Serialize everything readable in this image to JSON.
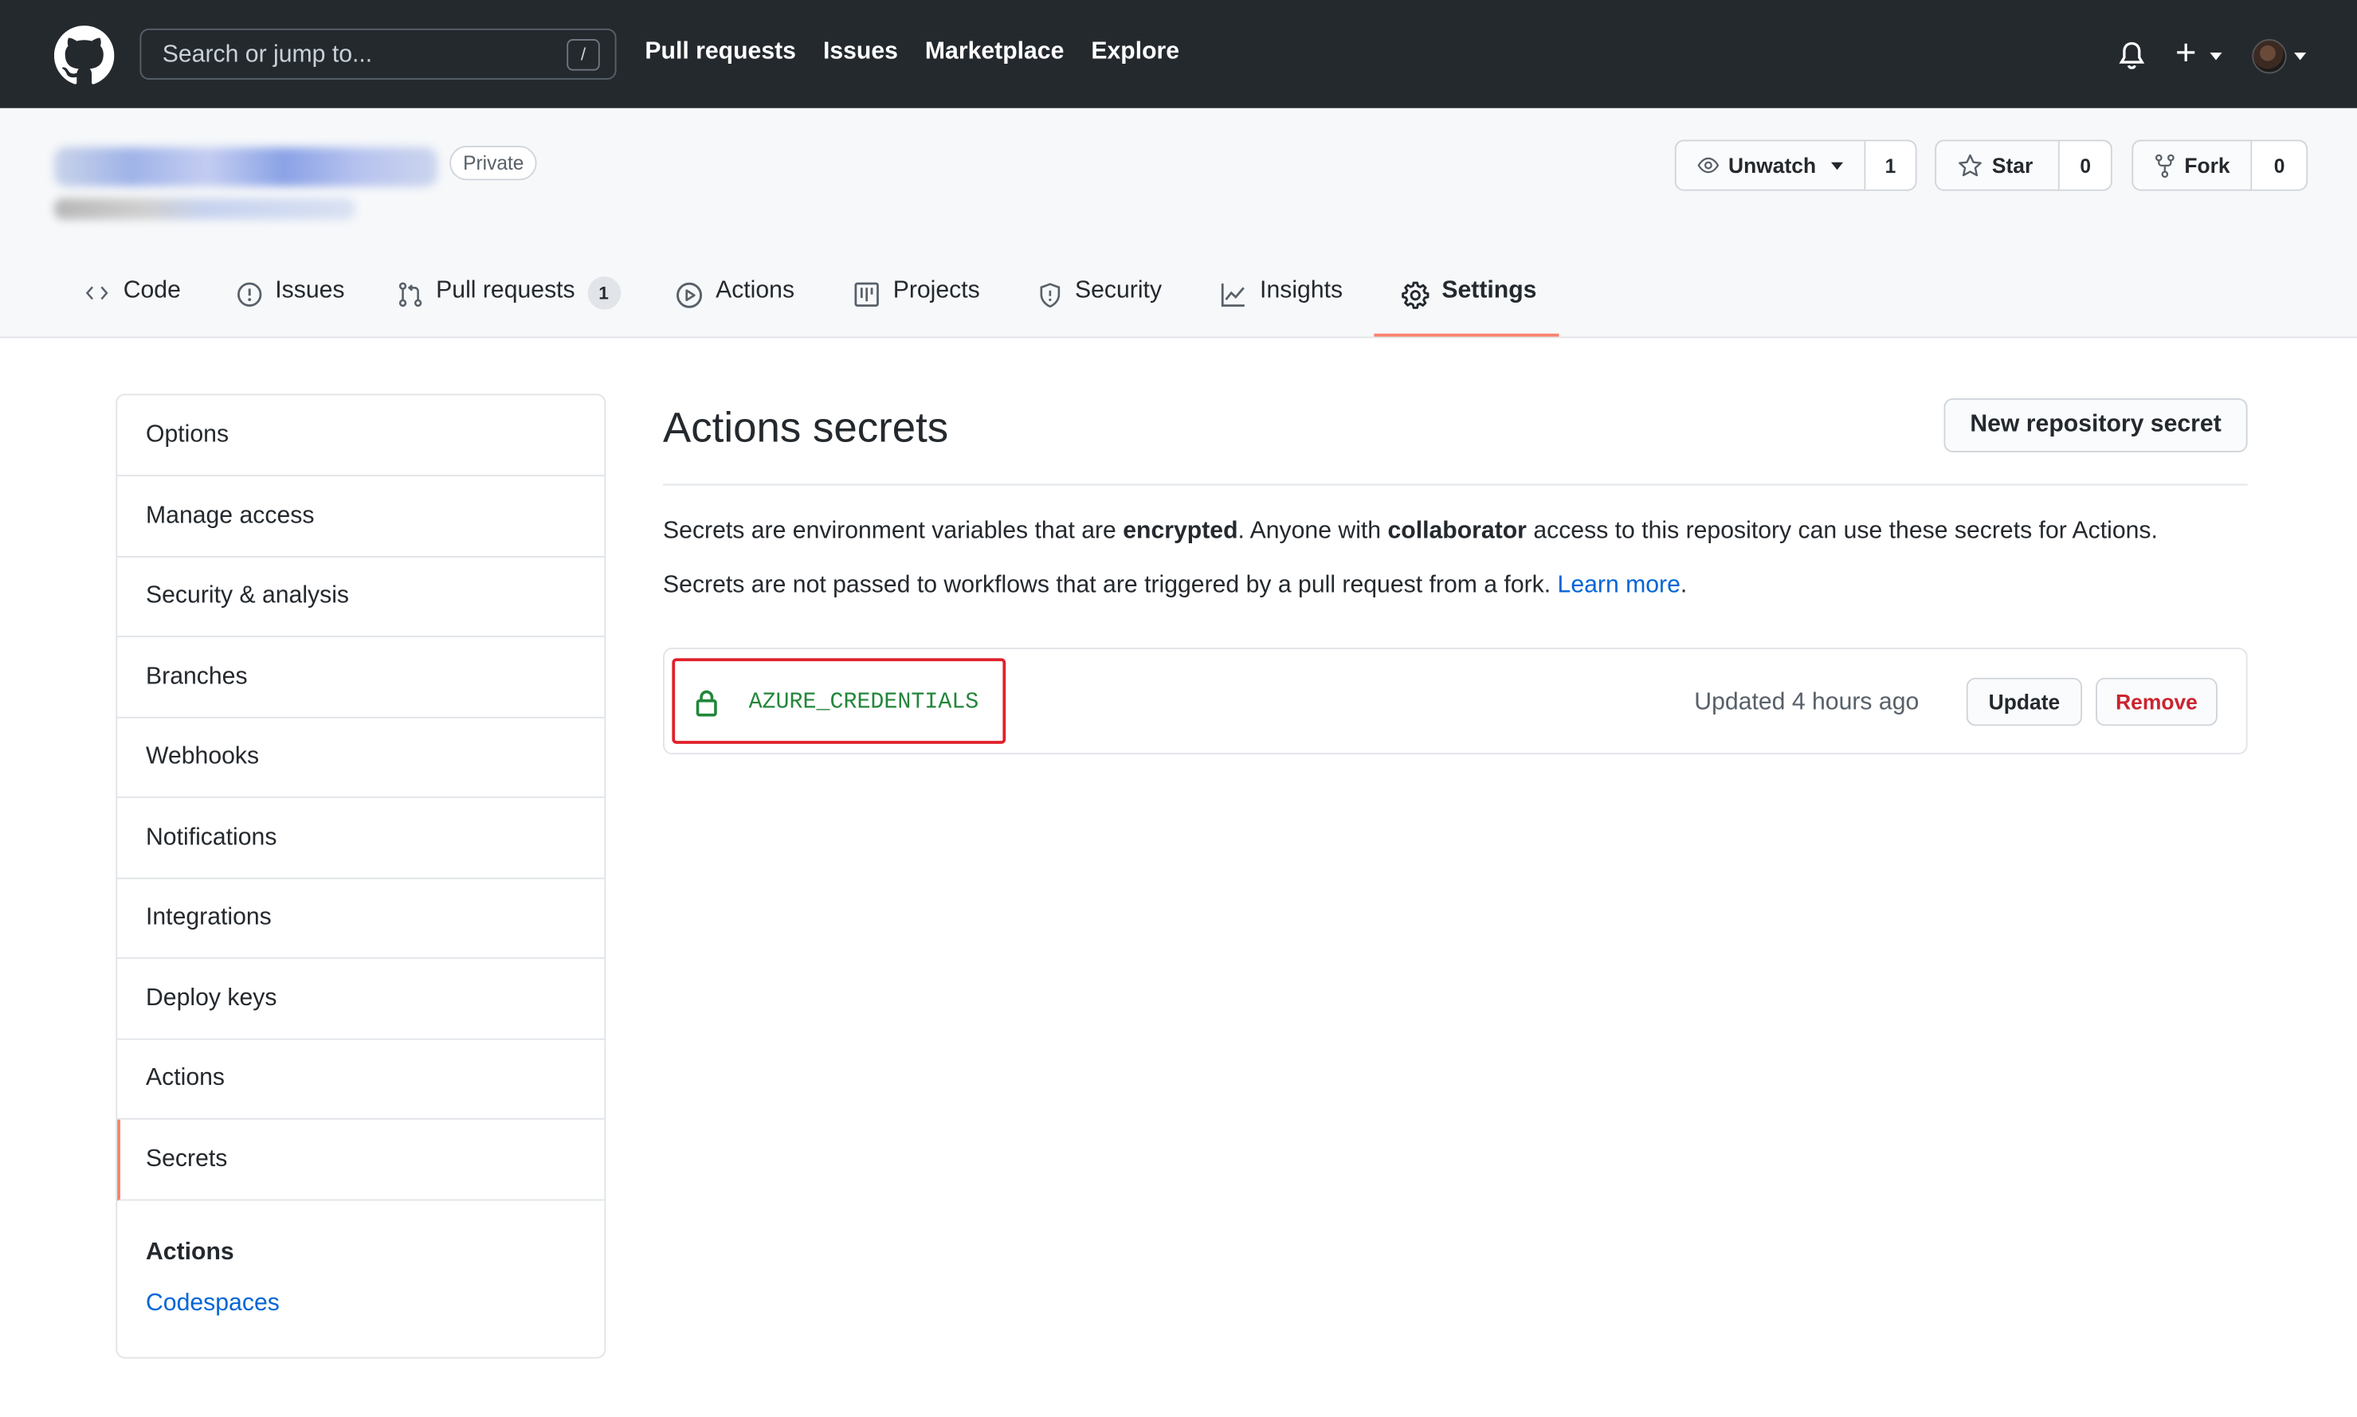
{
  "header": {
    "search_placeholder": "Search or jump to...",
    "search_shortcut": "/",
    "nav": [
      "Pull requests",
      "Issues",
      "Marketplace",
      "Explore"
    ],
    "plus": "+"
  },
  "repo": {
    "visibility": "Private",
    "watch": {
      "label": "Unwatch",
      "count": "1"
    },
    "star": {
      "label": "Star",
      "count": "0"
    },
    "fork": {
      "label": "Fork",
      "count": "0"
    }
  },
  "tabs": [
    {
      "label": "Code",
      "icon": "code-icon"
    },
    {
      "label": "Issues",
      "icon": "issue-icon"
    },
    {
      "label": "Pull requests",
      "icon": "pull-request-icon",
      "count": "1"
    },
    {
      "label": "Actions",
      "icon": "play-icon"
    },
    {
      "label": "Projects",
      "icon": "project-icon"
    },
    {
      "label": "Security",
      "icon": "shield-icon"
    },
    {
      "label": "Insights",
      "icon": "graph-icon"
    },
    {
      "label": "Settings",
      "icon": "gear-icon",
      "selected": true
    }
  ],
  "sidebar": {
    "items": [
      "Options",
      "Manage access",
      "Security & analysis",
      "Branches",
      "Webhooks",
      "Notifications",
      "Integrations",
      "Deploy keys",
      "Actions",
      "Secrets"
    ],
    "active": "Secrets",
    "section_heading": "Actions",
    "section_link": "Codespaces"
  },
  "main": {
    "title": "Actions secrets",
    "new_button": "New repository secret",
    "para1": {
      "t1": "Secrets are environment variables that are ",
      "b1": "encrypted",
      "t2": ". Anyone with ",
      "b2": "collaborator",
      "t3": " access to this repository can use these secrets for Actions."
    },
    "para2": {
      "t1": "Secrets are not passed to workflows that are triggered by a pull request from a fork. ",
      "link": "Learn more",
      "t2": "."
    },
    "secrets": [
      {
        "name": "AZURE_CREDENTIALS",
        "updated": "Updated 4 hours ago",
        "update_label": "Update",
        "remove_label": "Remove"
      }
    ]
  },
  "colors": {
    "header_bg": "#24292e",
    "tab_accent": "#f9826c",
    "link": "#0366d6",
    "secret_green": "#22863a",
    "danger": "#cb2431",
    "highlight_box": "#e0202a"
  }
}
